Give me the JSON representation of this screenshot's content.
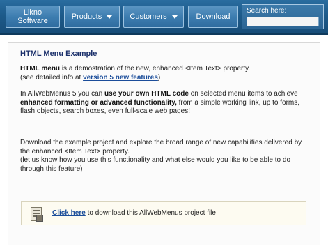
{
  "menu": {
    "items": [
      {
        "line1": "Likno",
        "line2": "Software"
      },
      {
        "label": "Products"
      },
      {
        "label": "Customers"
      },
      {
        "label": "Download"
      }
    ],
    "search_label": "Search here:",
    "search_value": ""
  },
  "content": {
    "title": "HTML Menu Example",
    "p1": {
      "bold1": "HTML menu",
      "t1": " is a demostration of the new, enhanced <Item Text> property.",
      "t2": "(see detailed info at ",
      "link": "version 5 new features",
      "t3": ")"
    },
    "p2": {
      "t1": "In AllWebMenus 5 you can ",
      "bold1": "use your own HTML code",
      "t2": " on selected menu items to achieve ",
      "bold2": "enhanced formatting or advanced functionality,",
      "t3": " from a simple working link, up to forms, flash objects, search boxes, even full-scale web pages!"
    },
    "p3": {
      "t1": "Download the example project and explore the broad range of new capabilities delivered by the enhanced <Item Text> property.",
      "t2": "(let us know how you use this functionality and what else would you like to be able to do through this feature)"
    },
    "download": {
      "link": "Click here",
      "text": " to download this AllWebMenus project file"
    }
  }
}
